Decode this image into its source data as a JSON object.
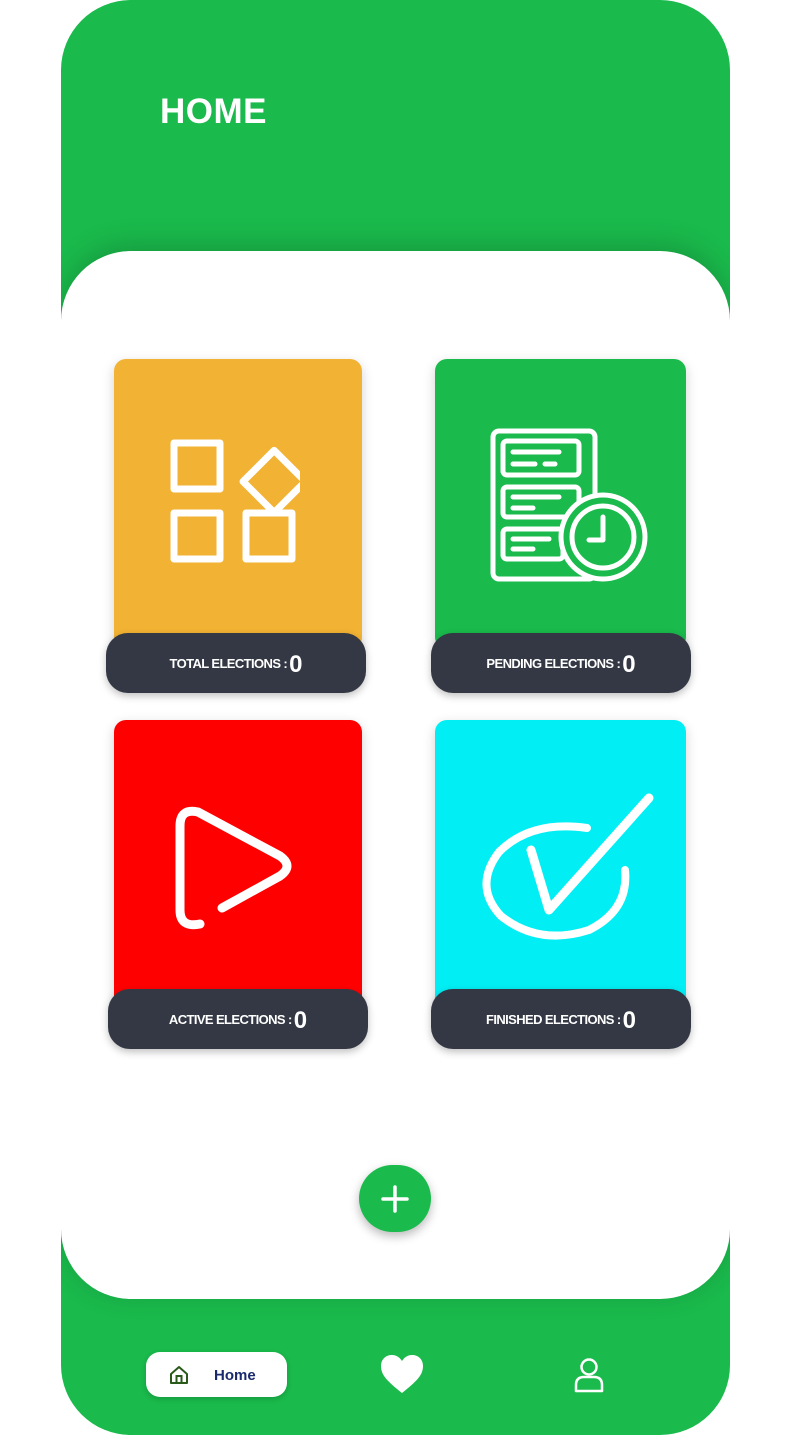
{
  "header": {
    "title": "HOME"
  },
  "cards": [
    {
      "label": "TOTAL ELECTIONS :",
      "count": "0",
      "color": "#f2b233",
      "icon": "apps-grid-icon"
    },
    {
      "label": "PENDING ELECTIONS :",
      "count": "0",
      "color": "#1aba4c",
      "icon": "document-clock-icon"
    },
    {
      "label": "ACTIVE ELECTIONS :",
      "count": "0",
      "color": "#ff0000",
      "icon": "play-icon"
    },
    {
      "label": "FINISHED ELECTIONS :",
      "count": "0",
      "color": "#00eef4",
      "icon": "check-circle-icon"
    }
  ],
  "fab": {
    "icon": "plus-icon"
  },
  "bottom_nav": {
    "items": [
      {
        "label": "Home",
        "icon": "home-icon",
        "active": true
      },
      {
        "label": "",
        "icon": "heart-icon",
        "active": false
      },
      {
        "label": "",
        "icon": "user-icon",
        "active": false
      }
    ]
  },
  "colors": {
    "brand": "#1aba4c",
    "label_bg": "#333844"
  }
}
